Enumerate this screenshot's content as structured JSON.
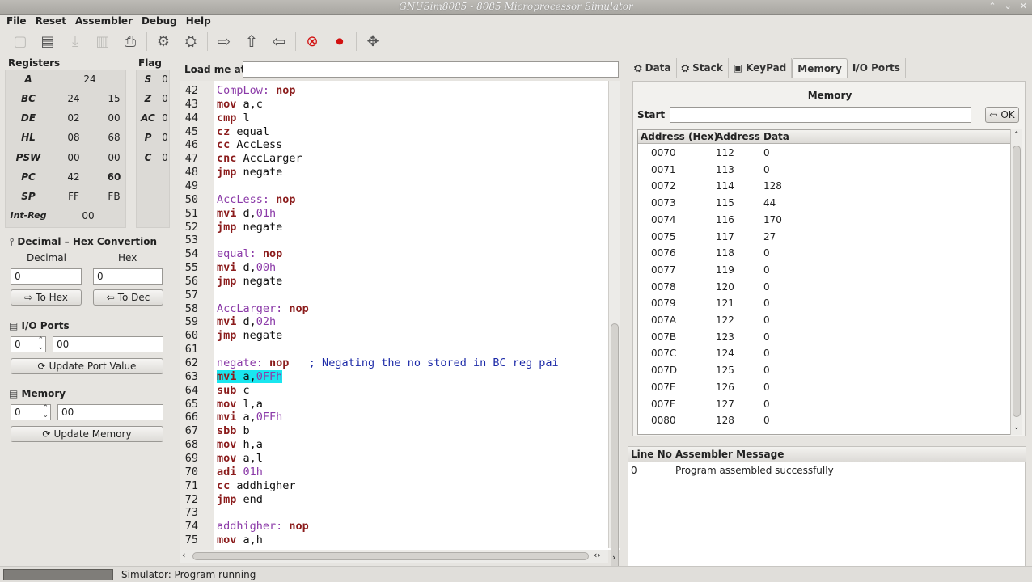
{
  "window": {
    "title": "GNUSim8085 - 8085 Microprocessor Simulator",
    "controls": [
      "⌃",
      "⌄",
      "✕"
    ]
  },
  "menu": [
    "File",
    "Reset",
    "Assembler",
    "Debug",
    "Help"
  ],
  "registers": {
    "title": "Registers",
    "rows": [
      {
        "name": "A",
        "v1": "24",
        "v2": ""
      },
      {
        "name": "BC",
        "v1": "24",
        "v2": "15"
      },
      {
        "name": "DE",
        "v1": "02",
        "v2": "00"
      },
      {
        "name": "HL",
        "v1": "08",
        "v2": "68"
      },
      {
        "name": "PSW",
        "v1": "00",
        "v2": "00"
      },
      {
        "name": "PC",
        "v1": "42",
        "v2": "60"
      },
      {
        "name": "SP",
        "v1": "FF",
        "v2": "FB"
      },
      {
        "name": "Int-Reg",
        "v1": "00",
        "v2": ""
      }
    ]
  },
  "flags": {
    "title": "Flag",
    "rows": [
      {
        "name": "S",
        "v": "0"
      },
      {
        "name": "Z",
        "v": "0"
      },
      {
        "name": "AC",
        "v": "0"
      },
      {
        "name": "P",
        "v": "0"
      },
      {
        "name": "C",
        "v": "0"
      }
    ]
  },
  "convert": {
    "title": "Decimal – Hex Convertion",
    "decimal_label": "Decimal",
    "hex_label": "Hex",
    "decimal_value": "0",
    "hex_value": "0",
    "to_hex": "To Hex",
    "to_dec": "To Dec"
  },
  "io": {
    "title": "I/O Ports",
    "port": "0",
    "value": "00",
    "button": "Update Port Value"
  },
  "memory_left": {
    "title": "Memory",
    "addr": "0",
    "value": "00",
    "button": "Update Memory"
  },
  "editor": {
    "load_label": "Load me at",
    "load_value": "",
    "lines": [
      {
        "n": "42",
        "tokens": [
          {
            "t": "CompLow: ",
            "c": "lbl"
          },
          {
            "t": "nop",
            "c": "kw"
          }
        ]
      },
      {
        "n": "43",
        "tokens": [
          {
            "t": "mov ",
            "c": "kw"
          },
          {
            "t": "a,c",
            "c": "id"
          }
        ]
      },
      {
        "n": "44",
        "tokens": [
          {
            "t": "cmp ",
            "c": "kw"
          },
          {
            "t": "l",
            "c": "id"
          }
        ]
      },
      {
        "n": "45",
        "tokens": [
          {
            "t": "cz ",
            "c": "kw"
          },
          {
            "t": "equal",
            "c": "id"
          }
        ]
      },
      {
        "n": "46",
        "tokens": [
          {
            "t": "cc ",
            "c": "kw"
          },
          {
            "t": "AccLess",
            "c": "id"
          }
        ]
      },
      {
        "n": "47",
        "tokens": [
          {
            "t": "cnc ",
            "c": "kw"
          },
          {
            "t": "AccLarger",
            "c": "id"
          }
        ]
      },
      {
        "n": "48",
        "tokens": [
          {
            "t": "jmp ",
            "c": "kw"
          },
          {
            "t": "negate",
            "c": "id"
          }
        ]
      },
      {
        "n": "49",
        "tokens": []
      },
      {
        "n": "50",
        "tokens": [
          {
            "t": "AccLess: ",
            "c": "lbl"
          },
          {
            "t": "nop",
            "c": "kw"
          }
        ]
      },
      {
        "n": "51",
        "tokens": [
          {
            "t": "mvi ",
            "c": "kw"
          },
          {
            "t": "d,",
            "c": "id"
          },
          {
            "t": "01h",
            "c": "num"
          }
        ]
      },
      {
        "n": "52",
        "tokens": [
          {
            "t": "jmp ",
            "c": "kw"
          },
          {
            "t": "negate",
            "c": "id"
          }
        ]
      },
      {
        "n": "53",
        "tokens": []
      },
      {
        "n": "54",
        "tokens": [
          {
            "t": "equal: ",
            "c": "lbl"
          },
          {
            "t": "nop",
            "c": "kw"
          }
        ]
      },
      {
        "n": "55",
        "tokens": [
          {
            "t": "mvi ",
            "c": "kw"
          },
          {
            "t": "d,",
            "c": "id"
          },
          {
            "t": "00h",
            "c": "num"
          }
        ]
      },
      {
        "n": "56",
        "tokens": [
          {
            "t": "jmp ",
            "c": "kw"
          },
          {
            "t": "negate",
            "c": "id"
          }
        ]
      },
      {
        "n": "57",
        "tokens": []
      },
      {
        "n": "58",
        "tokens": [
          {
            "t": "AccLarger: ",
            "c": "lbl"
          },
          {
            "t": "nop",
            "c": "kw"
          }
        ]
      },
      {
        "n": "59",
        "tokens": [
          {
            "t": "mvi ",
            "c": "kw"
          },
          {
            "t": "d,",
            "c": "id"
          },
          {
            "t": "02h",
            "c": "num"
          }
        ]
      },
      {
        "n": "60",
        "tokens": [
          {
            "t": "jmp ",
            "c": "kw"
          },
          {
            "t": "negate",
            "c": "id"
          }
        ]
      },
      {
        "n": "61",
        "tokens": []
      },
      {
        "n": "62",
        "tokens": [
          {
            "t": "negate: ",
            "c": "lbl"
          },
          {
            "t": "nop",
            "c": "kw"
          },
          {
            "t": "   ; Negating the no stored in BC reg pai",
            "c": "cmt"
          }
        ]
      },
      {
        "n": "63",
        "hl": true,
        "tokens": [
          {
            "t": "mvi ",
            "c": "kw"
          },
          {
            "t": "a,",
            "c": "id"
          },
          {
            "t": "0FFh",
            "c": "num"
          }
        ]
      },
      {
        "n": "64",
        "tokens": [
          {
            "t": "sub ",
            "c": "kw"
          },
          {
            "t": "c",
            "c": "id"
          }
        ]
      },
      {
        "n": "65",
        "tokens": [
          {
            "t": "mov ",
            "c": "kw"
          },
          {
            "t": "l,a",
            "c": "id"
          }
        ]
      },
      {
        "n": "66",
        "tokens": [
          {
            "t": "mvi ",
            "c": "kw"
          },
          {
            "t": "a,",
            "c": "id"
          },
          {
            "t": "0FFh",
            "c": "num"
          }
        ]
      },
      {
        "n": "67",
        "tokens": [
          {
            "t": "sbb ",
            "c": "kw"
          },
          {
            "t": "b",
            "c": "id"
          }
        ]
      },
      {
        "n": "68",
        "tokens": [
          {
            "t": "mov ",
            "c": "kw"
          },
          {
            "t": "h,a",
            "c": "id"
          }
        ]
      },
      {
        "n": "69",
        "tokens": [
          {
            "t": "mov ",
            "c": "kw"
          },
          {
            "t": "a,l",
            "c": "id"
          }
        ]
      },
      {
        "n": "70",
        "tokens": [
          {
            "t": "adi ",
            "c": "kw"
          },
          {
            "t": "01h",
            "c": "num"
          }
        ]
      },
      {
        "n": "71",
        "tokens": [
          {
            "t": "cc ",
            "c": "kw"
          },
          {
            "t": "addhigher",
            "c": "id"
          }
        ]
      },
      {
        "n": "72",
        "tokens": [
          {
            "t": "jmp ",
            "c": "kw"
          },
          {
            "t": "end",
            "c": "id"
          }
        ]
      },
      {
        "n": "73",
        "tokens": []
      },
      {
        "n": "74",
        "tokens": [
          {
            "t": "addhigher: ",
            "c": "lbl"
          },
          {
            "t": "nop",
            "c": "kw"
          }
        ]
      },
      {
        "n": "75",
        "tokens": [
          {
            "t": "mov ",
            "c": "kw"
          },
          {
            "t": "a,h",
            "c": "id"
          }
        ]
      }
    ]
  },
  "tabs": [
    {
      "label": "Data",
      "icon": "data-icon",
      "glyph": "⛭"
    },
    {
      "label": "Stack",
      "icon": "stack-icon",
      "glyph": "⛭"
    },
    {
      "label": "KeyPad",
      "icon": "keypad-icon",
      "glyph": "▣"
    },
    {
      "label": "Memory",
      "icon": "",
      "glyph": ""
    },
    {
      "label": "I/O Ports",
      "icon": "",
      "glyph": ""
    }
  ],
  "memory": {
    "title": "Memory",
    "start_label": "Start",
    "start_value": "",
    "ok": "OK",
    "headers": [
      "Address (Hex)",
      "Address",
      "Data"
    ],
    "rows": [
      [
        "0070",
        "112",
        "0"
      ],
      [
        "0071",
        "113",
        "0"
      ],
      [
        "0072",
        "114",
        "128"
      ],
      [
        "0073",
        "115",
        "44"
      ],
      [
        "0074",
        "116",
        "170"
      ],
      [
        "0075",
        "117",
        "27"
      ],
      [
        "0076",
        "118",
        "0"
      ],
      [
        "0077",
        "119",
        "0"
      ],
      [
        "0078",
        "120",
        "0"
      ],
      [
        "0079",
        "121",
        "0"
      ],
      [
        "007A",
        "122",
        "0"
      ],
      [
        "007B",
        "123",
        "0"
      ],
      [
        "007C",
        "124",
        "0"
      ],
      [
        "007D",
        "125",
        "0"
      ],
      [
        "007E",
        "126",
        "0"
      ],
      [
        "007F",
        "127",
        "0"
      ],
      [
        "0080",
        "128",
        "0"
      ]
    ]
  },
  "messages": {
    "headers": [
      "Line No",
      "Assembler Message"
    ],
    "rows": [
      [
        "0",
        "Program assembled successfully"
      ]
    ]
  },
  "status": {
    "text": "Simulator: Program running"
  }
}
